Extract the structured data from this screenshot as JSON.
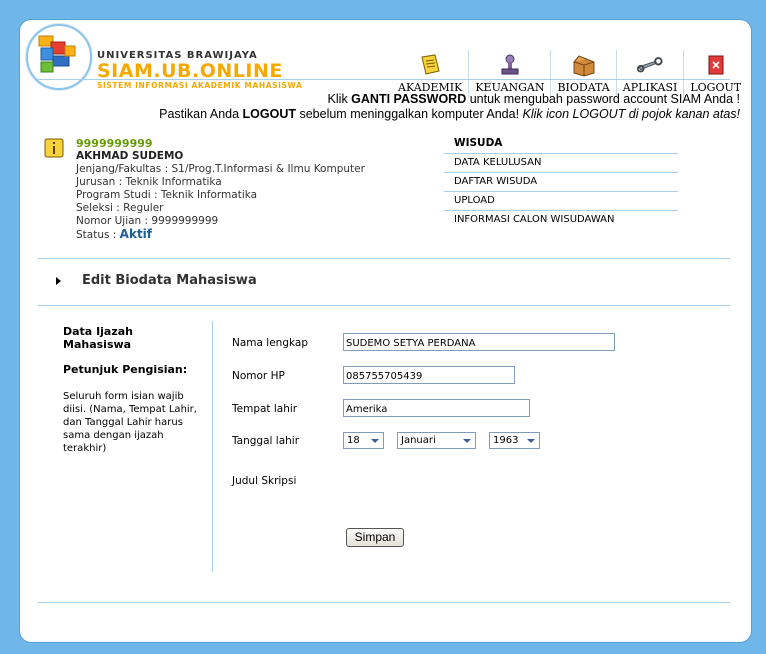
{
  "brand": {
    "university": "UNIVERSITAS BRAWIJAYA",
    "title": "SIAM.UB.ONLINE",
    "subtitle": "SISTEM INFORMASI AKADEMIK MAHASISWA"
  },
  "nav": [
    {
      "label": "AKADEMIK",
      "icon": "notepad-icon"
    },
    {
      "label": "KEUANGAN",
      "icon": "stamp-icon"
    },
    {
      "label": "BIODATA",
      "icon": "box-icon"
    },
    {
      "label": "APLIKASI",
      "icon": "wrench-icon"
    },
    {
      "label": "LOGOUT",
      "icon": "logout-icon"
    }
  ],
  "notice": {
    "line1_pre": "Klik ",
    "line1_bold": "GANTI PASSWORD",
    "line1_post": " untuk mengubah password account SIAM Anda !",
    "line2_pre": "Pastikan Anda ",
    "line2_bold": "LOGOUT",
    "line2_mid": " sebelum meninggalkan komputer Anda! ",
    "line2_italic": "Klik icon LOGOUT di pojok kanan atas!"
  },
  "profile": {
    "nim": "9999999999",
    "name": "AKHMAD SUDEMO",
    "jenjang": "Jenjang/Fakultas : S1/Prog.T.Informasi & Ilmu Komputer",
    "jurusan": "Jurusan : Teknik Informatika",
    "prodi": "Program Studi : Teknik Informatika",
    "seleksi": "Seleksi : Reguler",
    "nomor_ujian": "Nomor Ujian : 9999999999",
    "status_label": "Status : ",
    "status_value": "Aktif"
  },
  "wisuda": {
    "title": "WISUDA",
    "items": [
      "DATA KELULUSAN",
      "DAFTAR WISUDA",
      "UPLOAD",
      "INFORMASI CALON WISUDAWAN"
    ]
  },
  "section": {
    "title": "Edit Biodata Mahasiswa"
  },
  "sidebar": {
    "title": "Data Ijazah Mahasiswa",
    "guide_title": "Petunjuk Pengisian:",
    "guide_text": "Seluruh form isian wajib diisi. (Nama, Tempat Lahir, dan Tanggal Lahir harus sama dengan ijazah terakhir)"
  },
  "form": {
    "nama_label": "Nama lengkap",
    "nama_value": "SUDEMO SETYA PERDANA",
    "hp_label": "Nomor HP",
    "hp_value": "085755705439",
    "tempat_label": "Tempat lahir",
    "tempat_value": "Amerika",
    "tanggal_label": "Tanggal lahir",
    "day": "18",
    "month": "Januari",
    "year": "1963",
    "skripsi_label": "Judul Skripsi",
    "submit": "Simpan"
  },
  "colors": {
    "background": "#6fb6e9",
    "brand_orange": "#f5a800",
    "nim_green": "#669900",
    "status_blue": "#1c5f97",
    "divider": "#a8cfe9"
  }
}
